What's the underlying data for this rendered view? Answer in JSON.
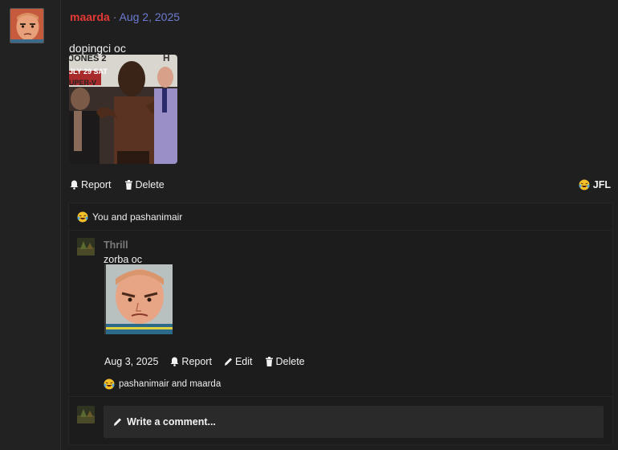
{
  "post": {
    "author": "maarda",
    "separator": "·",
    "date": "Aug 2, 2025",
    "text": "dopingci oc",
    "image_text": {
      "line1": "JONES 2",
      "line2": "JLY 29 SAT",
      "line3": "UPER-V",
      "corner": "H"
    },
    "actions": {
      "report": "Report",
      "delete": "Delete"
    },
    "reaction": {
      "emoji_icon": "laughing-tears-emoji-icon",
      "label": "JFL"
    }
  },
  "comments_section": {
    "reacted_by": "You and pashanimair",
    "comment": {
      "author": "Thrill",
      "text": "zorba oc",
      "date": "Aug 3, 2025",
      "report": "Report",
      "edit": "Edit",
      "delete": "Delete",
      "reactions": "pashanimair and maarda"
    },
    "write_placeholder": "Write a comment..."
  },
  "colors": {
    "author": "#e53935",
    "date": "#6c7bd1",
    "background": "#1b1b1b",
    "comment_author": "#7a7a7a"
  }
}
